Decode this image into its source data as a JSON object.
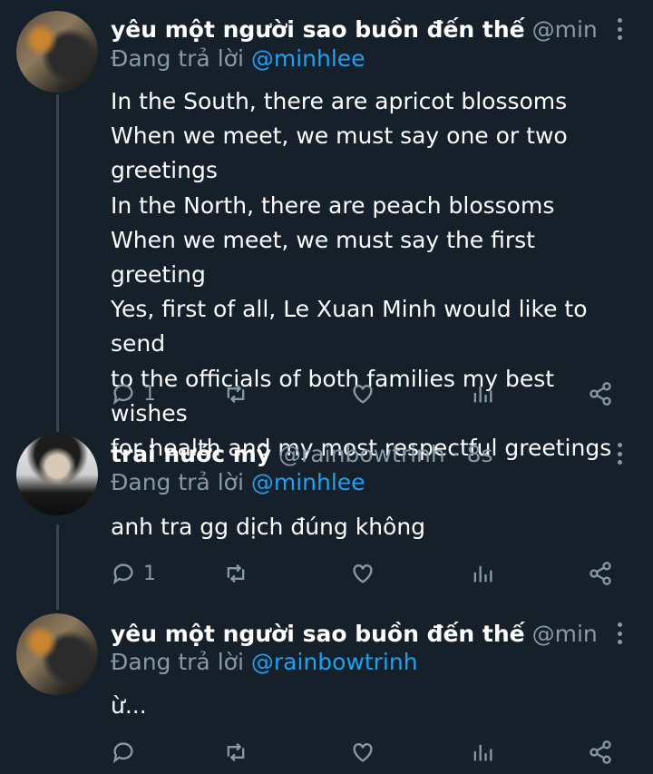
{
  "tweets": [
    {
      "name": "yêu một người sao buồn đến thế",
      "handle": "@minhlee ·...",
      "reply_prefix": "Đang trả lời",
      "reply_mention": "@minhlee",
      "text": "In the South, there are apricot blossoms\nWhen we meet, we must say one or two\ngreetings\nIn the North, there are peach blossoms\nWhen we meet, we must say the first greeting\nYes, first of all, Le Xuan Minh would like to send\nto the officials of both families my best wishes\nfor health and my most respectful greetings",
      "reply_count": "1"
    },
    {
      "name": "trai nước mỹ",
      "handle": "@rainbowtrinh · 8s",
      "reply_prefix": "Đang trả lời",
      "reply_mention": "@minhlee",
      "text": "anh tra gg dịch đúng không",
      "reply_count": "1"
    },
    {
      "name": "yêu một người sao buồn đến thế",
      "handle": "@minhlee ·...",
      "reply_prefix": "Đang trả lời",
      "reply_mention": "@rainbowtrinh",
      "text": "ừ...",
      "reply_count": ""
    }
  ],
  "icons": {
    "reply": "reply-icon",
    "retweet": "retweet-icon",
    "like": "heart-icon",
    "analytics": "analytics-icon",
    "share": "share-icon",
    "more": "more-icon"
  },
  "colors": {
    "background": "#15202b",
    "secondary_text": "#8899a6",
    "link": "#1da1f2",
    "thread_line": "#38444d"
  }
}
